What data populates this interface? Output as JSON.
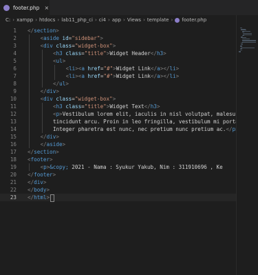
{
  "tab": {
    "title": "footer.php",
    "close": "×"
  },
  "breadcrumb": {
    "drive": "C:",
    "parts": [
      "xampp",
      "htdocs",
      "lab11_php_ci",
      "ci4",
      "app",
      "Views",
      "template"
    ],
    "file": "footer.php"
  },
  "current_line": 23,
  "lines": [
    {
      "n": "1",
      "indent": 1,
      "tokens": [
        [
          "p",
          "</"
        ],
        [
          "t",
          "section"
        ],
        [
          "p",
          ">"
        ]
      ]
    },
    {
      "n": "2",
      "indent": 2,
      "tokens": [
        [
          "p",
          "<"
        ],
        [
          "t",
          "aside"
        ],
        [
          "x",
          " "
        ],
        [
          "a",
          "id"
        ],
        [
          "x",
          "="
        ],
        [
          "s",
          "\"sidebar\""
        ],
        [
          "p",
          ">"
        ]
      ]
    },
    {
      "n": "3",
      "indent": 2,
      "tokens": [
        [
          "p",
          "<"
        ],
        [
          "t",
          "div"
        ],
        [
          "x",
          " "
        ],
        [
          "a",
          "class"
        ],
        [
          "x",
          "="
        ],
        [
          "s",
          "\"widget-box\""
        ],
        [
          "p",
          ">"
        ]
      ]
    },
    {
      "n": "4",
      "indent": 3,
      "tokens": [
        [
          "p",
          "<"
        ],
        [
          "t",
          "h3"
        ],
        [
          "x",
          " "
        ],
        [
          "a",
          "class"
        ],
        [
          "x",
          "="
        ],
        [
          "s",
          "\"title\""
        ],
        [
          "p",
          ">"
        ],
        [
          "x",
          "Widget Header"
        ],
        [
          "p",
          "</"
        ],
        [
          "t",
          "h3"
        ],
        [
          "p",
          ">"
        ]
      ]
    },
    {
      "n": "5",
      "indent": 3,
      "tokens": [
        [
          "p",
          "<"
        ],
        [
          "t",
          "ul"
        ],
        [
          "p",
          ">"
        ]
      ]
    },
    {
      "n": "6",
      "indent": 4,
      "tokens": [
        [
          "p",
          "<"
        ],
        [
          "t",
          "li"
        ],
        [
          "p",
          "><"
        ],
        [
          "t",
          "a"
        ],
        [
          "x",
          " "
        ],
        [
          "a",
          "href"
        ],
        [
          "x",
          "="
        ],
        [
          "s",
          "\"#\""
        ],
        [
          "p",
          ">"
        ],
        [
          "x",
          "Widget Link"
        ],
        [
          "p",
          "</"
        ],
        [
          "t",
          "a"
        ],
        [
          "p",
          "></"
        ],
        [
          "t",
          "li"
        ],
        [
          "p",
          ">"
        ]
      ]
    },
    {
      "n": "7",
      "indent": 4,
      "tokens": [
        [
          "p",
          "<"
        ],
        [
          "t",
          "li"
        ],
        [
          "p",
          "><"
        ],
        [
          "t",
          "a"
        ],
        [
          "x",
          " "
        ],
        [
          "a",
          "href"
        ],
        [
          "x",
          "="
        ],
        [
          "s",
          "\"#\""
        ],
        [
          "p",
          ">"
        ],
        [
          "x",
          "Widget Link"
        ],
        [
          "p",
          "</"
        ],
        [
          "t",
          "a"
        ],
        [
          "p",
          "></"
        ],
        [
          "t",
          "li"
        ],
        [
          "p",
          ">"
        ]
      ]
    },
    {
      "n": "8",
      "indent": 3,
      "tokens": [
        [
          "p",
          "</"
        ],
        [
          "t",
          "ul"
        ],
        [
          "p",
          ">"
        ]
      ]
    },
    {
      "n": "9",
      "indent": 2,
      "tokens": [
        [
          "p",
          "</"
        ],
        [
          "t",
          "div"
        ],
        [
          "p",
          ">"
        ]
      ]
    },
    {
      "n": "10",
      "indent": 2,
      "tokens": [
        [
          "p",
          "<"
        ],
        [
          "t",
          "div"
        ],
        [
          "x",
          " "
        ],
        [
          "a",
          "class"
        ],
        [
          "x",
          "="
        ],
        [
          "s",
          "\"widget-box\""
        ],
        [
          "p",
          ">"
        ]
      ]
    },
    {
      "n": "11",
      "indent": 3,
      "tokens": [
        [
          "p",
          "<"
        ],
        [
          "t",
          "h3"
        ],
        [
          "x",
          " "
        ],
        [
          "a",
          "class"
        ],
        [
          "x",
          "="
        ],
        [
          "s",
          "\"title\""
        ],
        [
          "p",
          ">"
        ],
        [
          "x",
          "Widget Text"
        ],
        [
          "p",
          "</"
        ],
        [
          "t",
          "h3"
        ],
        [
          "p",
          ">"
        ]
      ]
    },
    {
      "n": "12",
      "indent": 3,
      "tokens": [
        [
          "p",
          "<"
        ],
        [
          "t",
          "p"
        ],
        [
          "p",
          ">"
        ],
        [
          "x",
          "Vestibulum lorem elit, iaculis in nisl volutpat, malesu"
        ]
      ]
    },
    {
      "n": "13",
      "indent": 3,
      "tokens": [
        [
          "x",
          "tincidunt arcu. Proin in leo fringilla, vestibulum mi porta"
        ]
      ]
    },
    {
      "n": "14",
      "indent": 3,
      "tokens": [
        [
          "x",
          "Integer pharetra est nunc, nec pretium nunc pretium ac."
        ],
        [
          "p",
          "</"
        ],
        [
          "t",
          "p"
        ],
        [
          "p",
          ">"
        ]
      ]
    },
    {
      "n": "15",
      "indent": 2,
      "tokens": [
        [
          "p",
          "</"
        ],
        [
          "t",
          "div"
        ],
        [
          "p",
          ">"
        ]
      ]
    },
    {
      "n": "16",
      "indent": 2,
      "tokens": [
        [
          "p",
          "</"
        ],
        [
          "t",
          "aside"
        ],
        [
          "p",
          ">"
        ]
      ]
    },
    {
      "n": "17",
      "indent": 1,
      "tokens": [
        [
          "p",
          "</"
        ],
        [
          "t",
          "section"
        ],
        [
          "p",
          ">"
        ]
      ]
    },
    {
      "n": "18",
      "indent": 1,
      "tokens": [
        [
          "p",
          "<"
        ],
        [
          "t",
          "footer"
        ],
        [
          "p",
          ">"
        ]
      ]
    },
    {
      "n": "19",
      "indent": 2,
      "tokens": [
        [
          "p",
          "<"
        ],
        [
          "t",
          "p"
        ],
        [
          "p",
          ">"
        ],
        [
          "e",
          "&copy;"
        ],
        [
          "x",
          " 2021 - Nama : Syukur Yakub, Nim : 311910696 , Ke"
        ]
      ]
    },
    {
      "n": "20",
      "indent": 1,
      "tokens": [
        [
          "p",
          "</"
        ],
        [
          "t",
          "footer"
        ],
        [
          "p",
          ">"
        ]
      ]
    },
    {
      "n": "21",
      "indent": 1,
      "tokens": [
        [
          "p",
          "</"
        ],
        [
          "t",
          "div"
        ],
        [
          "p",
          ">"
        ]
      ]
    },
    {
      "n": "22",
      "indent": 0,
      "tokens": [
        [
          "p",
          "</"
        ],
        [
          "t",
          "body"
        ],
        [
          "p",
          ">"
        ]
      ]
    },
    {
      "n": "23",
      "indent": 0,
      "tokens": [
        [
          "p",
          "</"
        ],
        [
          "t",
          "html"
        ],
        [
          "p",
          ">"
        ]
      ]
    }
  ]
}
